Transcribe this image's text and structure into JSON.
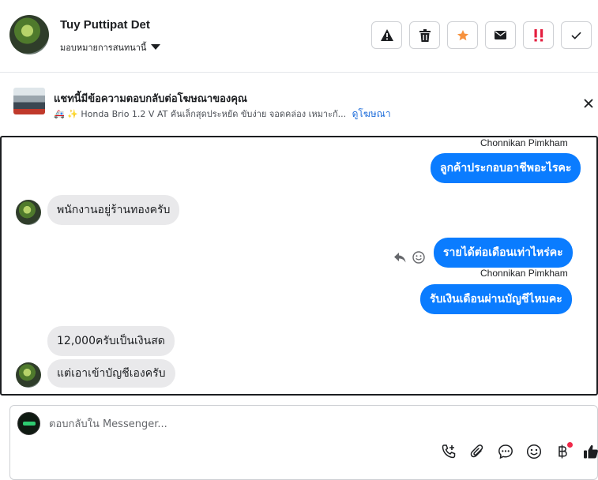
{
  "header": {
    "contact_name": "Tuy Puttipat Det",
    "assign_label": "มอบหมายการสนทนานี้"
  },
  "actions": [
    {
      "name": "report-spam-button",
      "icon": "warning-icon"
    },
    {
      "name": "delete-button",
      "icon": "trash-icon"
    },
    {
      "name": "star-button",
      "icon": "star-icon",
      "color": "#f7923e"
    },
    {
      "name": "mark-unread-button",
      "icon": "envelope-icon"
    },
    {
      "name": "priority-button",
      "icon": "exclamation-icon",
      "color": "#e41e3f"
    },
    {
      "name": "mark-done-button",
      "icon": "check-icon"
    }
  ],
  "ad": {
    "title": "แชทนี้มีข้อความตอบกลับต่อโฆษณาของคุณ",
    "subtitle": "🚑 ✨ Honda Brio 1.2 V AT คันเล็กสุดประหยัด ขับง่าย จอดคล่อง เหมาะกั...",
    "link": "ดูโฆษณา"
  },
  "thread": {
    "agent_name_1": "Chonnikan Pimkham",
    "msg_1": "ลูกค้าประกอบอาชีพอะไรคะ",
    "msg_2": "พนักงานอยู่ร้านทองครับ",
    "msg_3": "รายได้ต่อเดือนเท่าไหร่คะ",
    "agent_name_2": "Chonnikan Pimkham",
    "msg_4": "รับเงินเดือนผ่านบัญชีไหมคะ",
    "msg_5": "12,000ครับเป็นเงินสด",
    "msg_6": "แต่เอาเข้าบัญชีเองครับ"
  },
  "composer": {
    "placeholder": "ตอบกลับใน Messenger..."
  },
  "colors": {
    "outgoing_bubble": "#0a7cff",
    "incoming_bubble": "#e9e9eb",
    "link": "#216fdb"
  }
}
